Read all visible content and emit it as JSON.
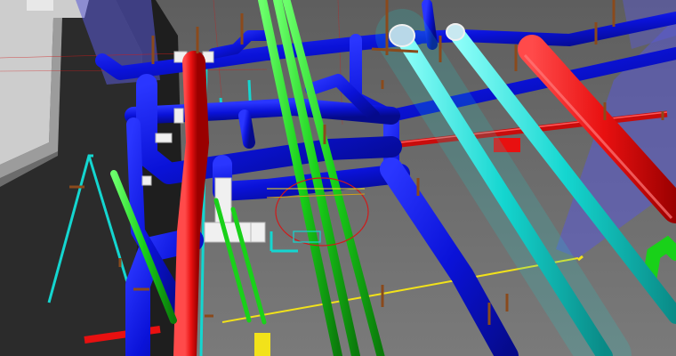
{
  "scene": {
    "subject": "3d-mep-pipe-coordination-model",
    "colors": {
      "background": "#6b6b6b",
      "wall_dark": "#2b2b2b",
      "wall_light": "#c8c8c8",
      "glass_panel": "#5a5ad6",
      "pipe_blue": "#0a12d8",
      "pipe_green": "#19d119",
      "pipe_cyan": "#14d6d0",
      "pipe_red": "#e81010",
      "pipe_white": "#f0f0f0",
      "hanger_brown": "#8a4a1c",
      "floor_line_yellow": "#f2e21a",
      "selection_ring": "#d01a1a"
    }
  }
}
